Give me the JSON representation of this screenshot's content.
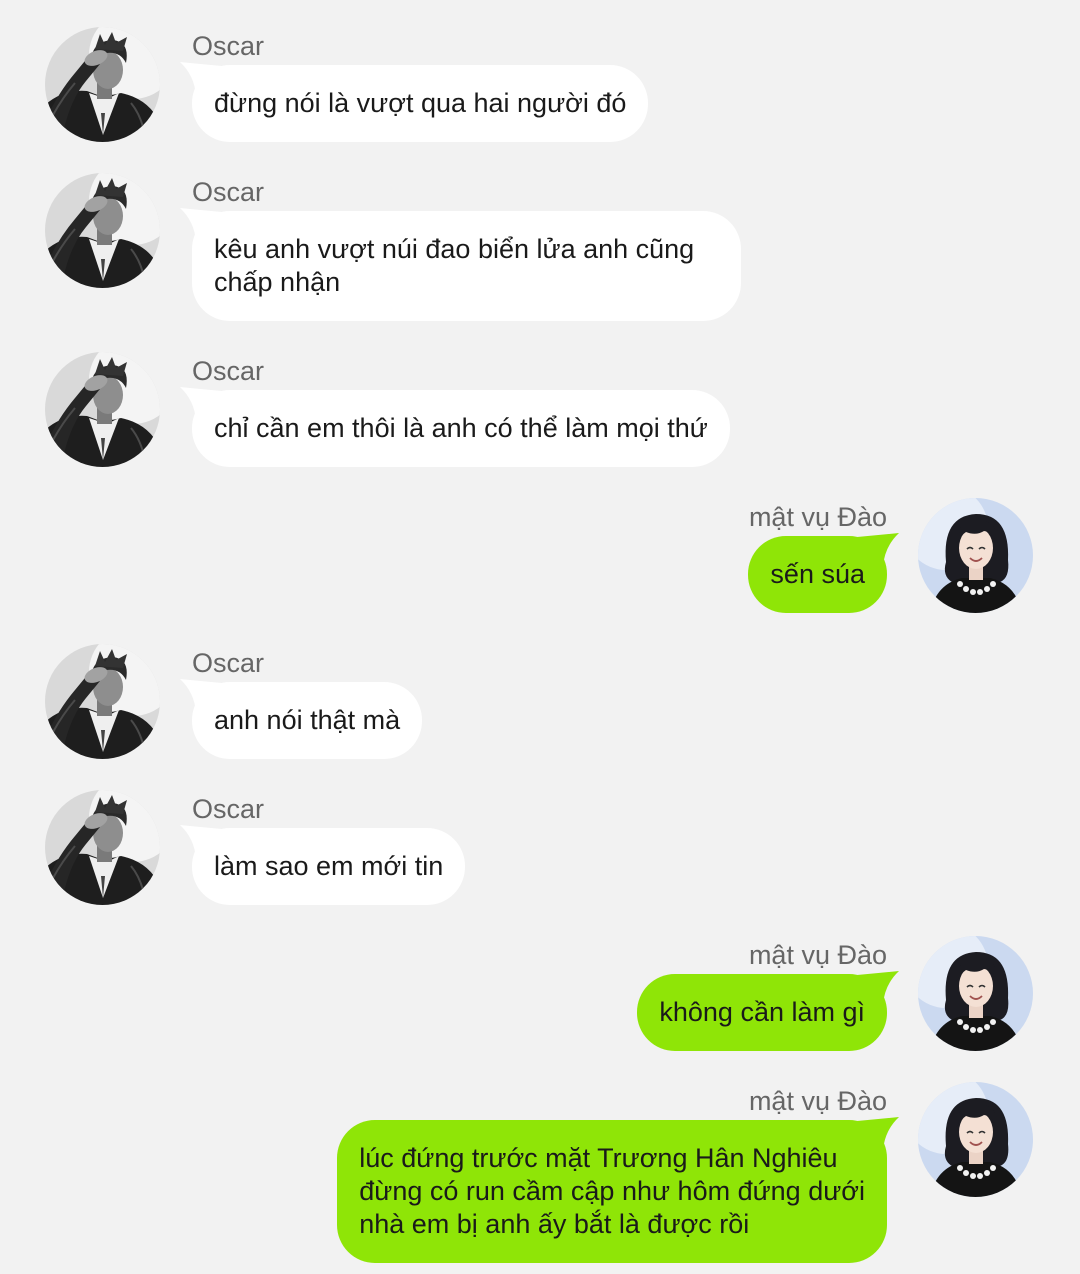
{
  "colors": {
    "background": "#f2f2f2",
    "incoming_bubble": "#ffffff",
    "outgoing_bubble": "#8fe507",
    "sender_name": "#666666",
    "message_text": "#1a1a1a"
  },
  "messages": [
    {
      "sender": "Oscar",
      "outgoing": false,
      "avatar_icon": "oscar-avatar-photo",
      "lines": [
        "đừng nói là vượt qua hai người đó"
      ]
    },
    {
      "sender": "Oscar",
      "outgoing": false,
      "avatar_icon": "oscar-avatar-photo",
      "lines": [
        "kêu anh vượt núi đao biển lửa anh cũng",
        "chấp nhận"
      ]
    },
    {
      "sender": "Oscar",
      "outgoing": false,
      "avatar_icon": "oscar-avatar-photo",
      "lines": [
        "chỉ cần em thôi là anh có thể làm mọi thứ"
      ]
    },
    {
      "sender": "mật vụ Đào",
      "outgoing": true,
      "avatar_icon": "dao-avatar-photo",
      "lines": [
        "sến súa"
      ]
    },
    {
      "sender": "Oscar",
      "outgoing": false,
      "avatar_icon": "oscar-avatar-photo",
      "lines": [
        "anh nói thật mà"
      ]
    },
    {
      "sender": "Oscar",
      "outgoing": false,
      "avatar_icon": "oscar-avatar-photo",
      "lines": [
        "làm sao em mới tin"
      ]
    },
    {
      "sender": "mật vụ Đào",
      "outgoing": true,
      "avatar_icon": "dao-avatar-photo",
      "lines": [
        "không cần làm gì"
      ]
    },
    {
      "sender": "mật vụ Đào",
      "outgoing": true,
      "avatar_icon": "dao-avatar-photo",
      "lines": [
        "lúc đứng trước mặt Trương Hân Nghiêu",
        "đừng có run cầm cập như hôm đứng dưới",
        "nhà em bị anh ấy bắt là được rồi"
      ]
    }
  ]
}
